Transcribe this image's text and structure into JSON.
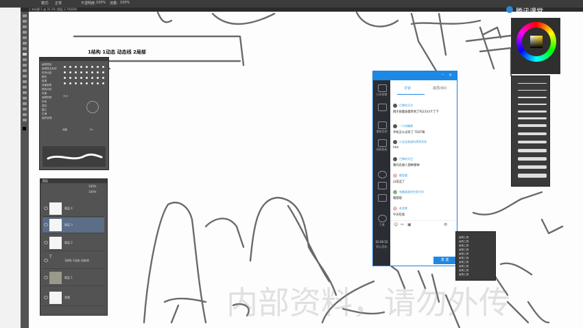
{
  "optionbar": {
    "items": [
      "模式:",
      "正常",
      "不透明度:",
      "100%",
      "流量:",
      "100%"
    ]
  },
  "tabbar": {
    "doc_title": "1 未标题-1 @ 33.3% (图层 3, RGB/8)"
  },
  "canvas_annotation": "1结构    1动态  动态线  2局部",
  "brush_panel": {
    "rows": [
      "画笔预设",
      "画笔笔尖形状",
      "形状动态",
      "散布",
      "纹理",
      "双重画笔",
      "颜色动态",
      "传递",
      "画笔笔势",
      "杂色",
      "湿边",
      "建立",
      "平滑",
      "保护纹理"
    ],
    "size_label": "大小",
    "spacing_label": "间距",
    "spacing_value": "1%"
  },
  "layers_panel": {
    "header": "图层",
    "opacity": "100%",
    "fill": "100%",
    "layers": [
      {
        "name": "图层 4"
      },
      {
        "name": "图层 3",
        "selected": true
      },
      {
        "name": "图层 2"
      },
      {
        "name": "1结构  1动态  动态线"
      },
      {
        "name": "图层 1"
      },
      {
        "name": "背景"
      }
    ]
  },
  "chat": {
    "side_labels": [
      "分享屏幕",
      "",
      "播放音频",
      "画图面板",
      "",
      "",
      "",
      "下课"
    ],
    "timer": "02:06:52",
    "timer_label": "默认音轨",
    "tabs": [
      {
        "label": "讨论",
        "active": true
      },
      {
        "label": "成员(60)",
        "active": false
      }
    ],
    "messages": [
      {
        "name": "巴黎的天空",
        "text": "刚才画着画着死机了吗2333卡了下"
      },
      {
        "name": "一只米糖酱",
        "text": "手机怎么没有了 TEST啊"
      },
      {
        "name": "小宝宝画画的漂亮男孩",
        "text": "hhh"
      },
      {
        "name": "巴黎的天空",
        "text": "我吗有想人那种那种"
      },
      {
        "name": "橘里猫",
        "text": "以前这了"
      },
      {
        "name": "有趣画画的在努力学",
        "text": "嗯嗯嗯"
      },
      {
        "name": "毛毛熊",
        "text": "今天吃啥"
      }
    ],
    "send_label": "发 送",
    "icons": [
      "chat-icon",
      "mic-icon",
      "screen-icon"
    ]
  },
  "tool_list": {
    "items": [
      "画笔工具",
      "画笔工具",
      "画笔工具",
      "画笔工具",
      "画笔工具",
      "画笔工具",
      "画笔工具",
      "画笔工具",
      "画笔工具",
      "画笔工具"
    ]
  },
  "logo": {
    "text": "腾讯课堂"
  },
  "watermark": "内部资料，请勿外传",
  "colors": {
    "accent": "#1e88e5",
    "panel": "#535353",
    "chat_side": "#2a2d33"
  }
}
